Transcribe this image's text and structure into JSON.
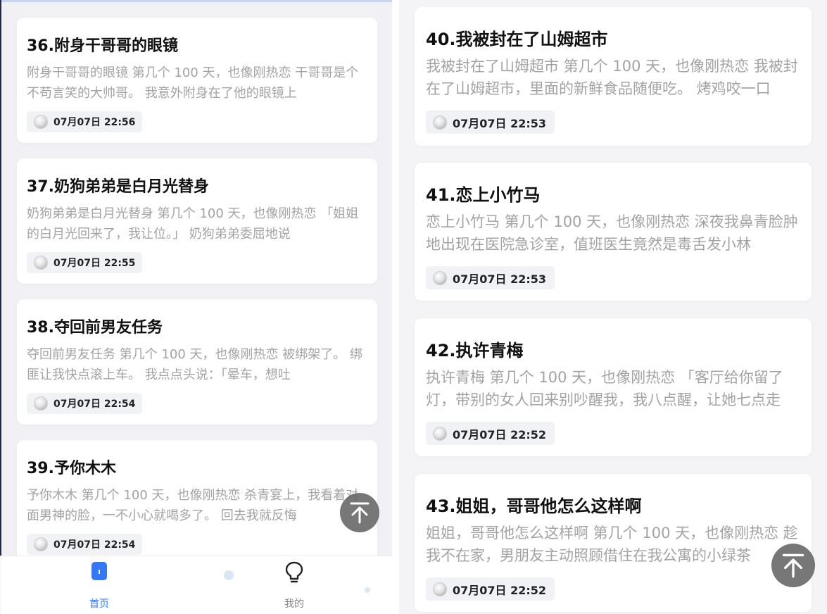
{
  "left_pane": {
    "cards": [
      {
        "title": "36.附身干哥哥的眼镜",
        "summary": "附身干哥哥的眼镜 第几个 100 天，也像刚热恋 干哥哥是个不苟言笑的大帅哥。 我意外附身在了他的眼镜上",
        "date": "07月07日 22:56"
      },
      {
        "title": "37.奶狗弟弟是白月光替身",
        "summary": "奶狗弟弟是白月光替身 第几个 100 天，也像刚热恋 「姐姐的白月光回来了，我让位。」 奶狗弟弟委屈地说",
        "date": "07月07日 22:55"
      },
      {
        "title": "38.夺回前男友任务",
        "summary": "夺回前男友任务 第几个 100 天，也像刚热恋 被绑架了。 绑匪让我快点滚上车。 我点点头说：「晕车，想吐",
        "date": "07月07日 22:54"
      },
      {
        "title": "39.予你木木",
        "summary": "予你木木 第几个 100 天，也像刚热恋 杀青宴上，我看着对面男神的脸，一不小心就喝多了。 回去我就反悔",
        "date": "07月07日 22:54"
      }
    ],
    "nav": {
      "home_label": "首页",
      "mine_label": "我的",
      "active_color": "#3478f6",
      "inactive_color": "#888888"
    }
  },
  "right_pane": {
    "cards": [
      {
        "title": "40.我被封在了山姆超市",
        "summary": "我被封在了山姆超市 第几个 100 天，也像刚热恋 我被封在了山姆超市，里面的新鲜食品随便吃。 烤鸡咬一口",
        "date": "07月07日 22:53"
      },
      {
        "title": "41.恋上小竹马",
        "summary": "恋上小竹马 第几个 100 天，也像刚热恋 深夜我鼻青脸肿地出现在医院急诊室，值班医生竟然是毒舌发小林",
        "date": "07月07日 22:53"
      },
      {
        "title": "42.执许青梅",
        "summary": "执许青梅 第几个 100 天，也像刚热恋 「客厅给你留了灯，带别的女人回来别吵醒我，我八点醒，让她七点走",
        "date": "07月07日 22:52"
      },
      {
        "title": "43.姐姐，哥哥他怎么这样啊",
        "summary": "姐姐，哥哥他怎么这样啊 第几个 100 天，也像刚热恋 趁我不在家，男朋友主动照顾借住在我公寓的小绿茶",
        "date": "07月07日 22:52"
      }
    ]
  },
  "icons": {
    "avatar": "avatar-icon",
    "scroll_top": "arrow-up-to-top-icon",
    "home": "home-icon",
    "mine": "lightbulb-icon"
  }
}
